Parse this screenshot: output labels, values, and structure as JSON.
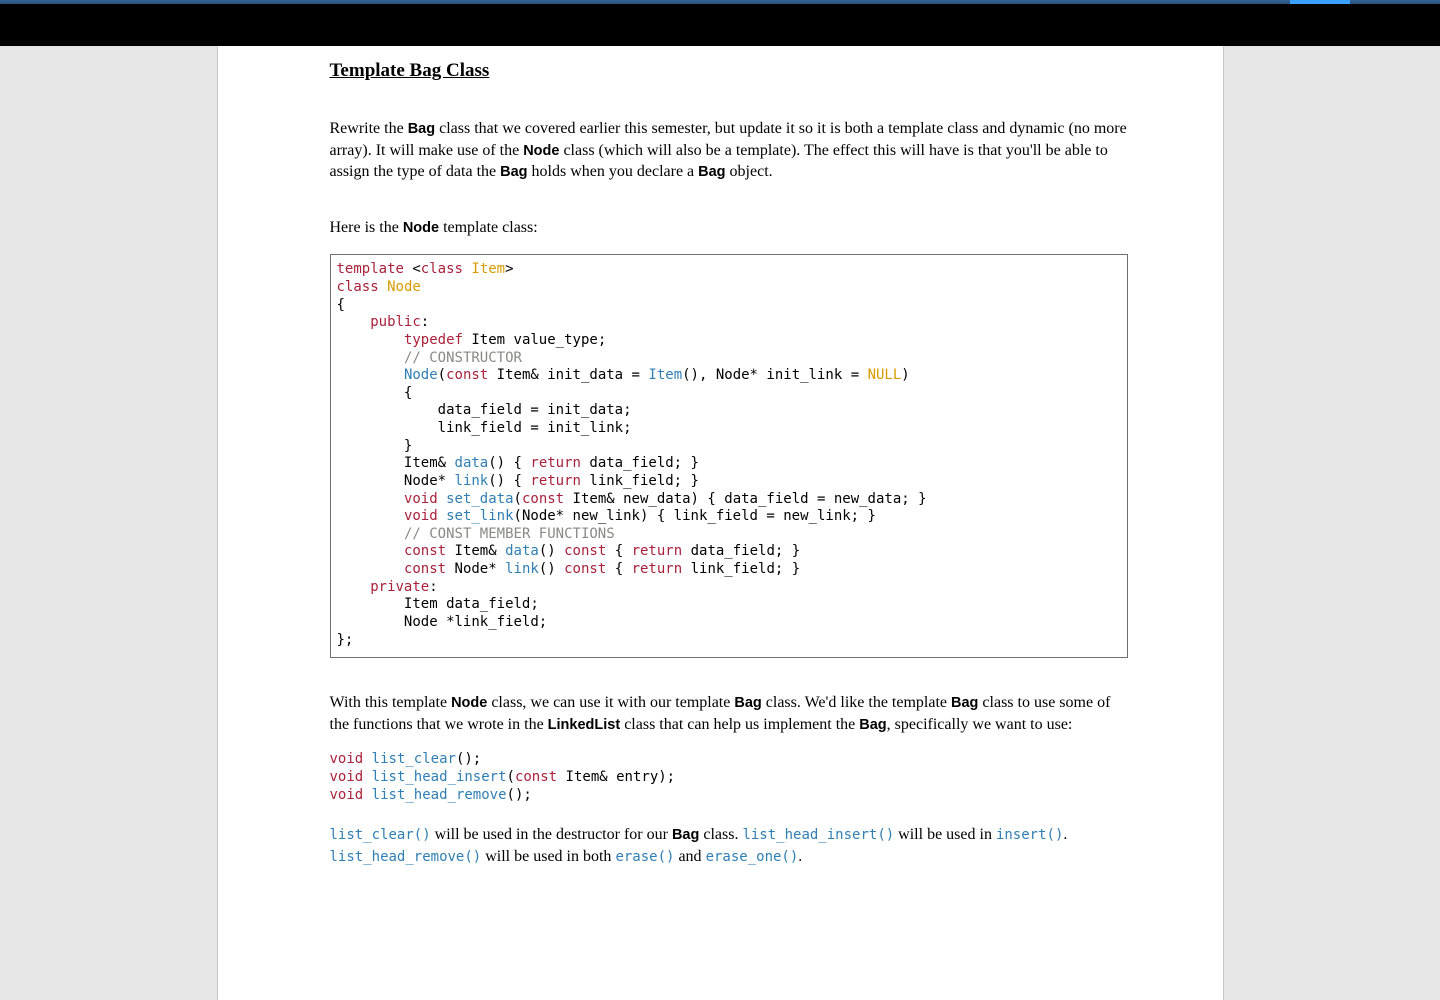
{
  "title": "Template Bag Class",
  "para1": {
    "t1": "Rewrite the ",
    "b1": "Bag",
    "t2": " class that we covered earlier this semester, but update it so it is both a template class and dynamic (no more array). It will make use of the ",
    "b2": "Node",
    "t3": " class (which will also be a template). The effect this will have is that you'll be able to assign the type of data the ",
    "b3": "Bag",
    "t4": " holds when you declare a ",
    "b4": "Bag",
    "t5": " object."
  },
  "para2": {
    "t1": "Here is the ",
    "b1": "Node",
    "t2": " template class:"
  },
  "node_code": {
    "l01a": "template",
    "l01b": " <",
    "l01c": "class",
    "l01d": " ",
    "l01e": "Item",
    "l01f": ">",
    "l02a": "class",
    "l02b": " ",
    "l02c": "Node",
    "l03a": "{",
    "l04a": "    ",
    "l04b": "public",
    "l04c": ":",
    "l05a": "        ",
    "l05b": "typedef",
    "l05c": " Item value_type;",
    "l06a": "        ",
    "l06b": "// CONSTRUCTOR",
    "l07a": "        ",
    "l07b": "Node",
    "l07c": "(",
    "l07d": "const",
    "l07e": " Item& init_data = ",
    "l07f": "Item",
    "l07g": "(), Node* init_link = ",
    "l07h": "NULL",
    "l07i": ")",
    "l08a": "        {",
    "l09a": "            data_field = init_data;",
    "l10a": "            link_field = init_link;",
    "l11a": "        }",
    "l12a": "        Item& ",
    "l12b": "data",
    "l12c": "() { ",
    "l12d": "return",
    "l12e": " data_field; }",
    "l13a": "        Node* ",
    "l13b": "link",
    "l13c": "() { ",
    "l13d": "return",
    "l13e": " link_field; }",
    "l14a": "        ",
    "l14b": "void",
    "l14c": " ",
    "l14d": "set_data",
    "l14e": "(",
    "l14f": "const",
    "l14g": " Item& new_data) { data_field = new_data; }",
    "l15a": "        ",
    "l15b": "void",
    "l15c": " ",
    "l15d": "set_link",
    "l15e": "(Node* new_link) { link_field = new_link; }",
    "l16a": "        ",
    "l16b": "// CONST MEMBER FUNCTIONS",
    "l17a": "        ",
    "l17b": "const",
    "l17c": " Item& ",
    "l17d": "data",
    "l17e": "() ",
    "l17f": "const",
    "l17g": " { ",
    "l17h": "return",
    "l17i": " data_field; }",
    "l18a": "        ",
    "l18b": "const",
    "l18c": " Node* ",
    "l18d": "link",
    "l18e": "() ",
    "l18f": "const",
    "l18g": " { ",
    "l18h": "return",
    "l18i": " link_field; }",
    "l19a": "    ",
    "l19b": "private",
    "l19c": ":",
    "l20a": "        Item data_field;",
    "l21a": "        Node *link_field;",
    "l22a": "};"
  },
  "para3": {
    "t1": "With this template ",
    "b1": "Node",
    "t2": " class, we can use it with our template ",
    "b2": "Bag",
    "t3": " class. We'd like the template ",
    "b3": "Bag",
    "t4": " class to use some of the functions that we wrote in the ",
    "b4": "LinkedList",
    "t5": " class that can help us implement the ",
    "b5": "Bag",
    "t6": ", specifically we want to use:"
  },
  "funclist": {
    "f1a": "void",
    "f1b": " ",
    "f1c": "list_clear",
    "f1d": "();",
    "f2a": "void",
    "f2b": " ",
    "f2c": "list_head_insert",
    "f2d": "(",
    "f2e": "const",
    "f2f": " Item& entry);",
    "f3a": "void",
    "f3b": " ",
    "f3c": "list_head_remove",
    "f3d": "();"
  },
  "para4": {
    "c1": "list_clear()",
    "t1": " will be used in the destructor for our ",
    "b1": "Bag",
    "t2": " class. ",
    "c2": "list_head_insert()",
    "t3": " will be used in ",
    "c3": "insert()",
    "t4": ". ",
    "c4": "list_head_remove()",
    "t5": " will be used in both ",
    "c5": "erase()",
    "t6": " and ",
    "c6": "erase_one()",
    "t7": "."
  }
}
